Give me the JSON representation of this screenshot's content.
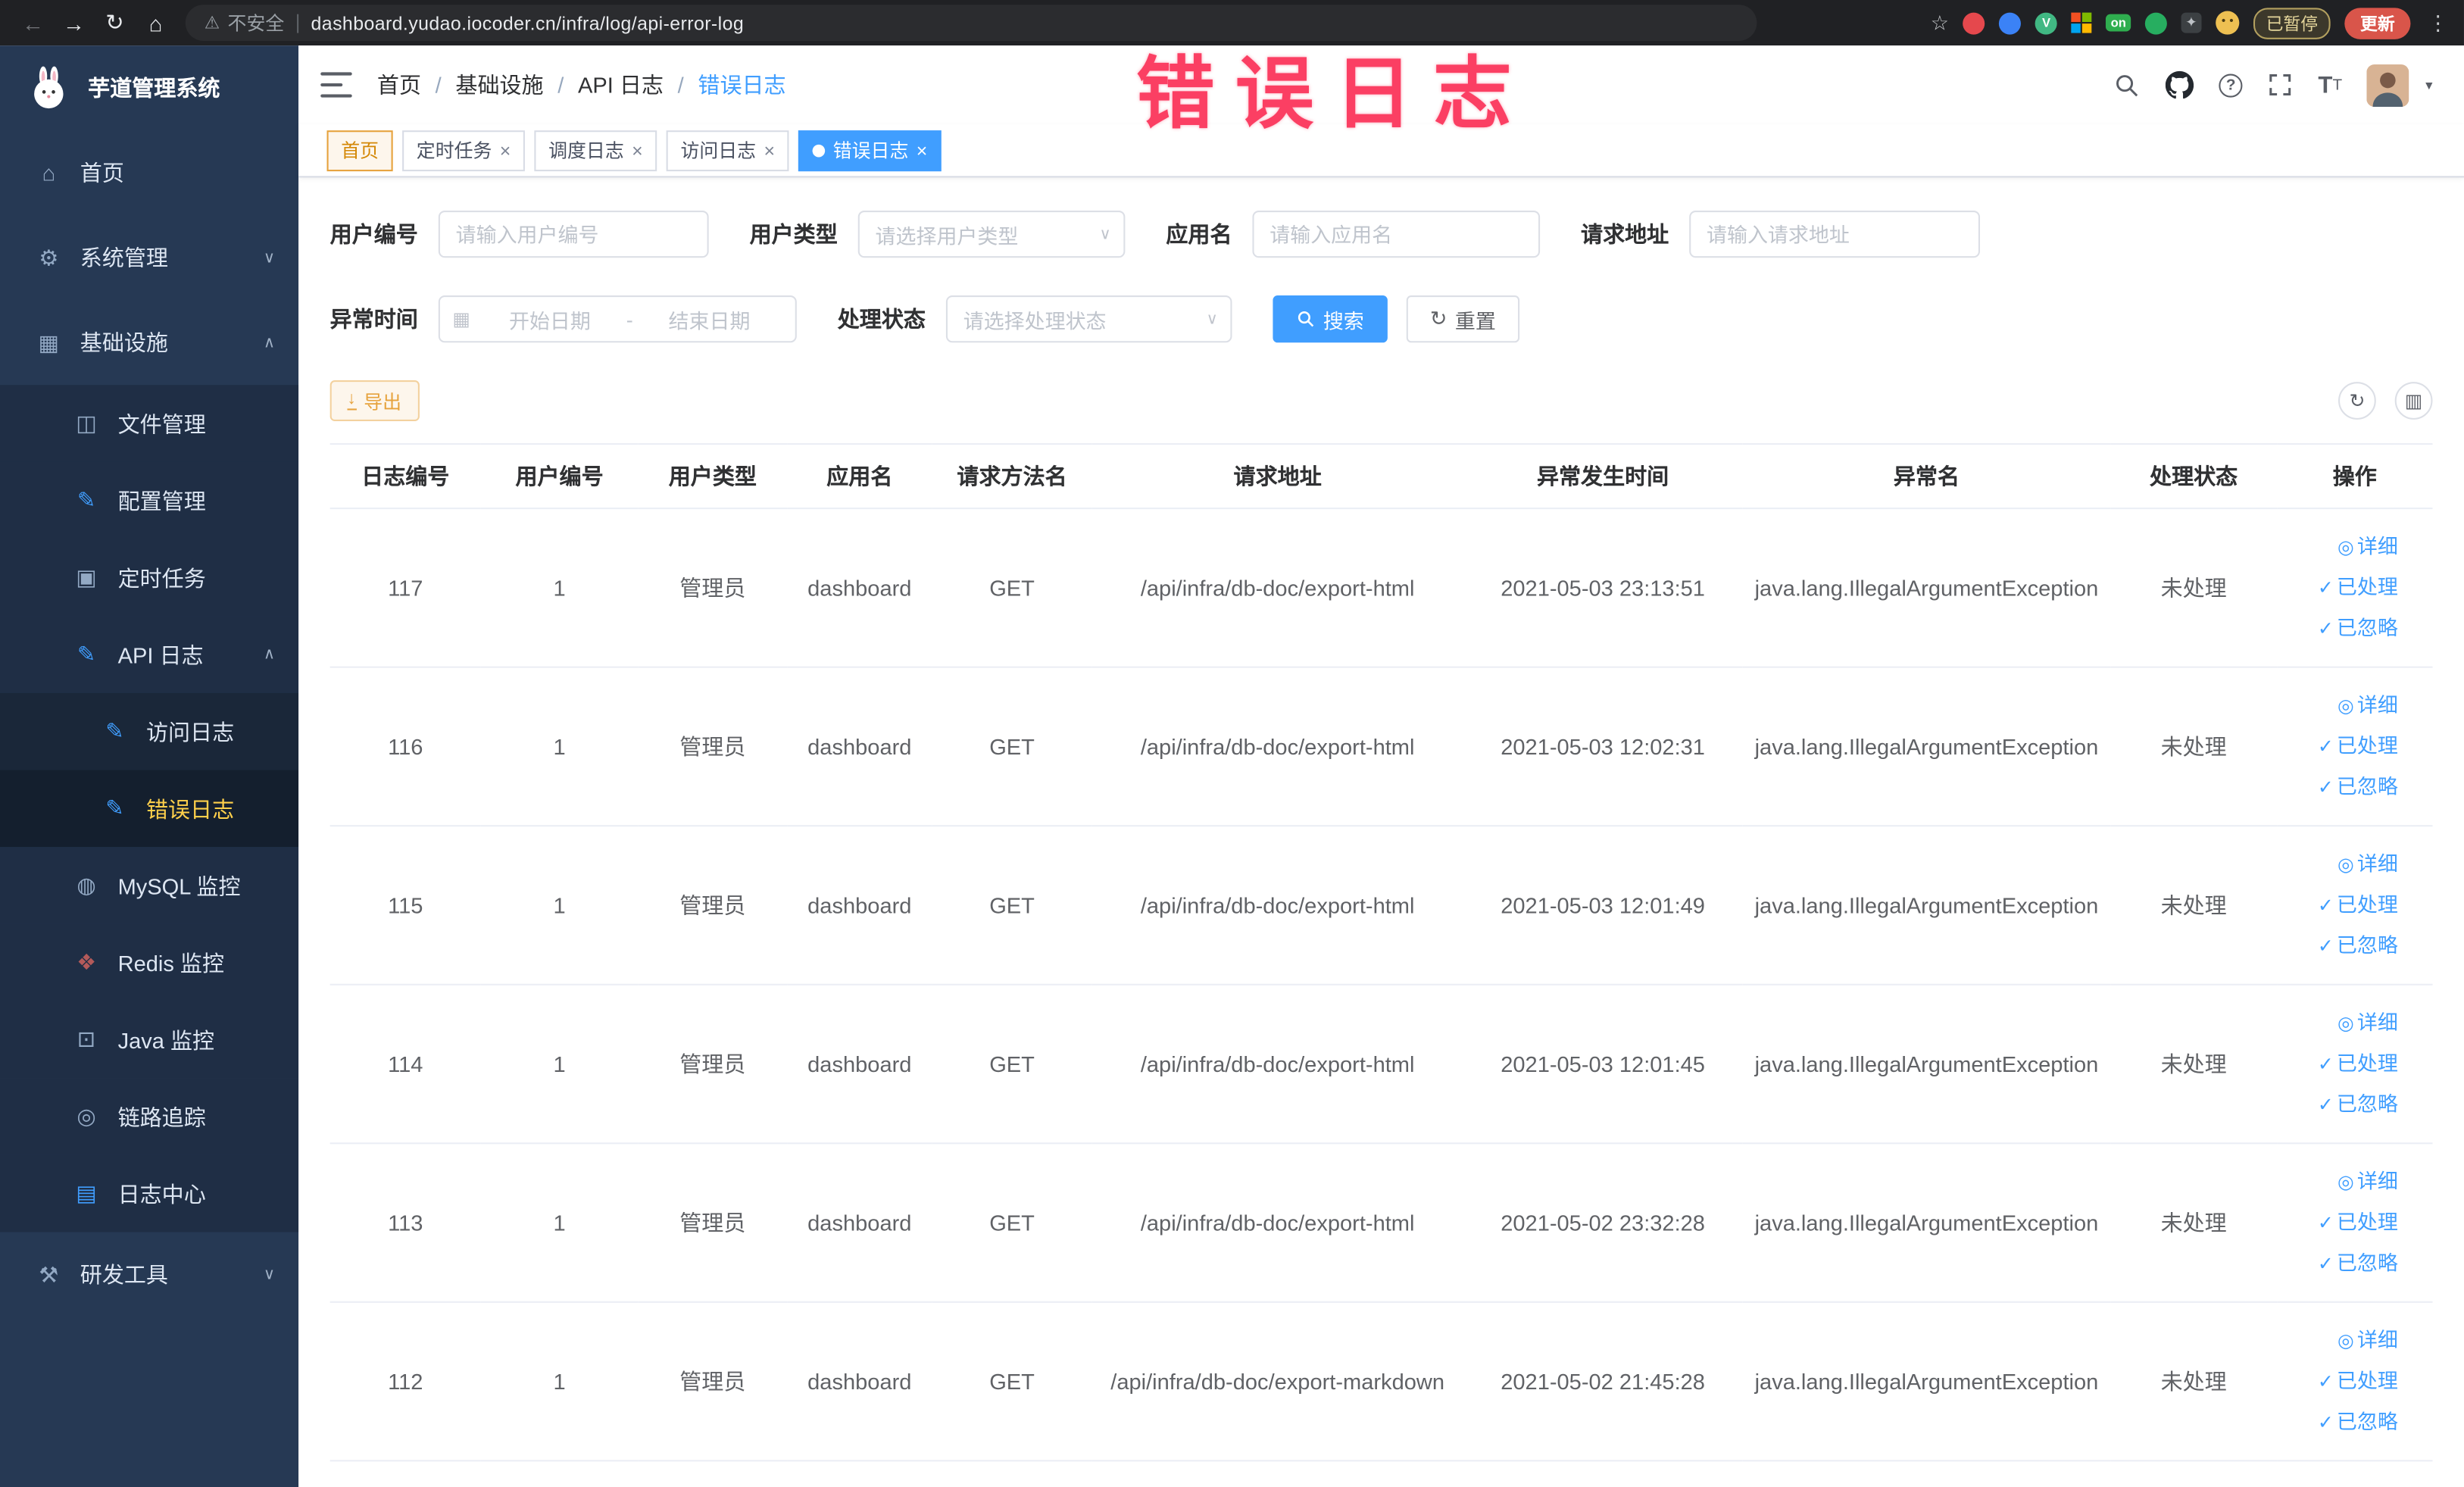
{
  "annotation": "错误日志",
  "colors": {
    "accent": "#409eff",
    "active_menu_text": "#ffd04b",
    "annotation": "#fb3f63",
    "warning": "#e6a23c",
    "update_button_bg": "#d9554a"
  },
  "icons": {
    "home": "⌂",
    "gear": "⚙",
    "infra": "▦",
    "folder": "◫",
    "edit": "✎",
    "task": "▣",
    "db": "◍",
    "redis": "❖",
    "java": "⊡",
    "trace": "◎",
    "logcenter": "▤",
    "tools": "⚒",
    "caret_down": "∨",
    "caret_up": "∧",
    "close": "×",
    "check": "✓",
    "eye": "◎",
    "refresh": "↻",
    "grid": "▥",
    "download": "↓",
    "calendar": "▦",
    "warning_triangle": "⚠",
    "star": "☆",
    "back": "←",
    "forward": "→",
    "reload": "↻",
    "kebab": "⋮",
    "dropdown": "▾"
  },
  "browser": {
    "security_label": "不安全",
    "url": "dashboard.yudao.iocoder.cn/infra/log/api-error-log",
    "extensions": {
      "vue_badge": "V",
      "on_badge": "on",
      "paused_badge": "已暂停",
      "update_button": "更新"
    }
  },
  "sidebar": {
    "logo_title": "芋道管理系统",
    "menu": [
      {
        "label": "首页"
      },
      {
        "label": "系统管理"
      },
      {
        "label": "基础设施"
      },
      {
        "label": "文件管理"
      },
      {
        "label": "配置管理"
      },
      {
        "label": "定时任务"
      },
      {
        "label": "API 日志"
      },
      {
        "label": "访问日志"
      },
      {
        "label": "错误日志"
      },
      {
        "label": "MySQL 监控"
      },
      {
        "label": "Redis 监控"
      },
      {
        "label": "Java 监控"
      },
      {
        "label": "链路追踪"
      },
      {
        "label": "日志中心"
      },
      {
        "label": "研发工具"
      }
    ]
  },
  "header": {
    "separator": "/",
    "breadcrumbs": [
      {
        "label": "首页"
      },
      {
        "label": "基础设施"
      },
      {
        "label": "API 日志"
      },
      {
        "label": "错误日志"
      }
    ]
  },
  "tabs": [
    {
      "label": "首页"
    },
    {
      "label": "定时任务"
    },
    {
      "label": "调度日志"
    },
    {
      "label": "访问日志"
    },
    {
      "label": "错误日志"
    }
  ],
  "filters": {
    "user_id_label": "用户编号",
    "user_id_placeholder": "请输入用户编号",
    "user_type_label": "用户类型",
    "user_type_placeholder": "请选择用户类型",
    "app_name_label": "应用名",
    "app_name_placeholder": "请输入应用名",
    "request_url_label": "请求地址",
    "request_url_placeholder": "请输入请求地址",
    "exception_time_label": "异常时间",
    "date_start_placeholder": "开始日期",
    "date_separator": "-",
    "date_end_placeholder": "结束日期",
    "process_status_label": "处理状态",
    "process_status_placeholder": "请选择处理状态",
    "search_button": "搜索",
    "reset_button": "重置"
  },
  "toolbar": {
    "export_button": "导出"
  },
  "table": {
    "columns": [
      "日志编号",
      "用户编号",
      "用户类型",
      "应用名",
      "请求方法名",
      "请求地址",
      "异常发生时间",
      "异常名",
      "处理状态",
      "操作"
    ],
    "actions": {
      "detail": "详细",
      "processed": "已处理",
      "ignored": "已忽略"
    },
    "rows": [
      {
        "id": "117",
        "user_id": "1",
        "user_type": "管理员",
        "app": "dashboard",
        "method": "GET",
        "url": "/api/infra/db-doc/export-html",
        "time": "2021-05-03 23:13:51",
        "exception": "java.lang.IllegalArgumentException",
        "status": "未处理"
      },
      {
        "id": "116",
        "user_id": "1",
        "user_type": "管理员",
        "app": "dashboard",
        "method": "GET",
        "url": "/api/infra/db-doc/export-html",
        "time": "2021-05-03 12:02:31",
        "exception": "java.lang.IllegalArgumentException",
        "status": "未处理"
      },
      {
        "id": "115",
        "user_id": "1",
        "user_type": "管理员",
        "app": "dashboard",
        "method": "GET",
        "url": "/api/infra/db-doc/export-html",
        "time": "2021-05-03 12:01:49",
        "exception": "java.lang.IllegalArgumentException",
        "status": "未处理"
      },
      {
        "id": "114",
        "user_id": "1",
        "user_type": "管理员",
        "app": "dashboard",
        "method": "GET",
        "url": "/api/infra/db-doc/export-html",
        "time": "2021-05-03 12:01:45",
        "exception": "java.lang.IllegalArgumentException",
        "status": "未处理"
      },
      {
        "id": "113",
        "user_id": "1",
        "user_type": "管理员",
        "app": "dashboard",
        "method": "GET",
        "url": "/api/infra/db-doc/export-html",
        "time": "2021-05-02 23:32:28",
        "exception": "java.lang.IllegalArgumentException",
        "status": "未处理"
      },
      {
        "id": "112",
        "user_id": "1",
        "user_type": "管理员",
        "app": "dashboard",
        "method": "GET",
        "url": "/api/infra/db-doc/export-markdown",
        "time": "2021-05-02 21:45:28",
        "exception": "java.lang.IllegalArgumentException",
        "status": "未处理"
      }
    ]
  }
}
